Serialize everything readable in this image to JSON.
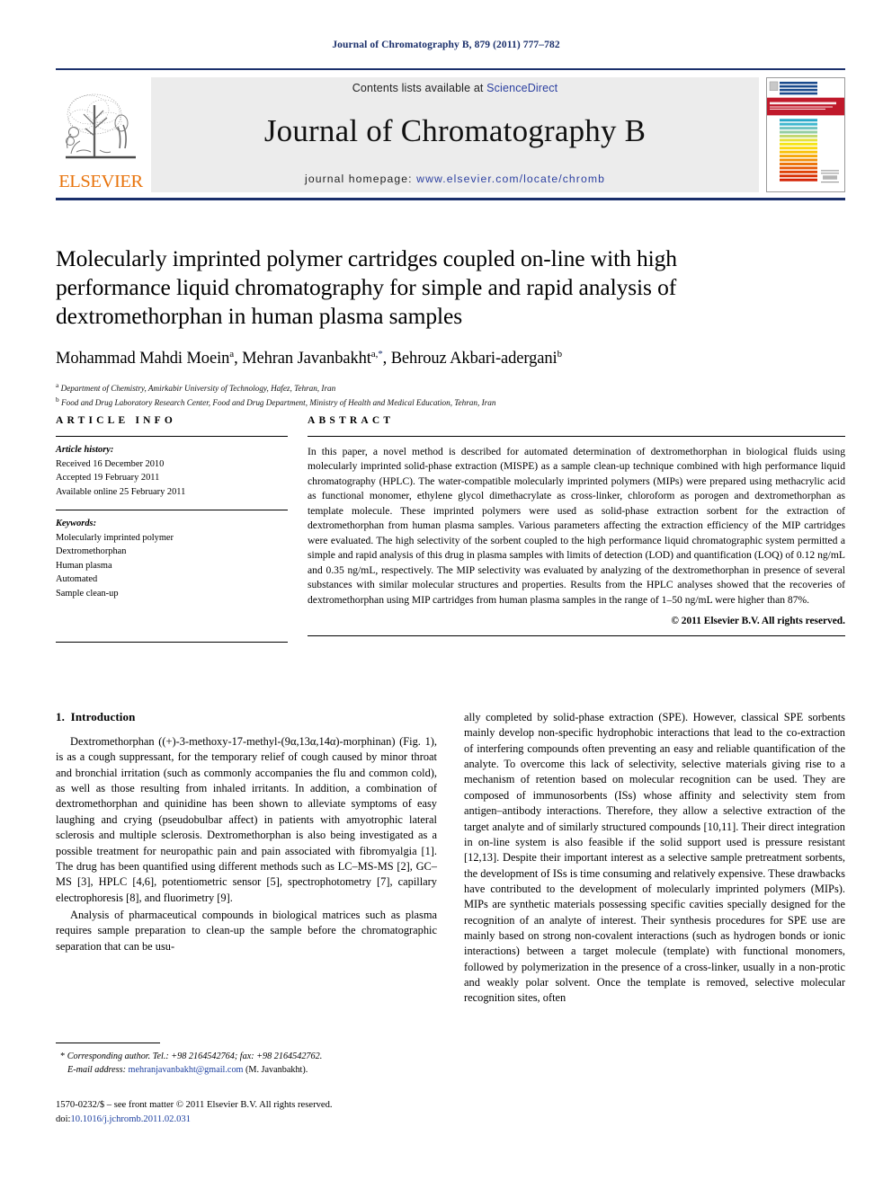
{
  "running_head": "Journal of Chromatography B, 879 (2011) 777–782",
  "masthead": {
    "contents_prefix": "Contents lists available at ",
    "sciencedirect": "ScienceDirect",
    "journal_title": "Journal of Chromatography B",
    "homepage_prefix": "journal homepage: ",
    "homepage_url": "www.elsevier.com/locate/chromb",
    "publisher": "ELSEVIER",
    "cover_title": "JOURNAL OF CHROMATOGRAPHY B",
    "accent_blue": "#1a2f6b",
    "link_blue": "#2b3fa0",
    "elsevier_orange": "#E8730B",
    "cover_red": "#c0192b"
  },
  "article": {
    "title": "Molecularly imprinted polymer cartridges coupled on-line with high performance liquid chromatography for simple and rapid analysis of dextromethorphan in human plasma samples",
    "authors_html": "Mohammad Mahdi Moein<sup>a</sup>, Mehran Javanbakht<sup>a,<span class=\"star\">*</span></sup>, Behrouz Akbari-adergani<sup>b</sup>",
    "affiliations": [
      {
        "mark": "a",
        "text": "Department of Chemistry, Amirkabir University of Technology, Hafez, Tehran, Iran"
      },
      {
        "mark": "b",
        "text": "Food and Drug Laboratory Research Center, Food and Drug Department, Ministry of Health and Medical Education, Tehran, Iran"
      }
    ]
  },
  "article_info": {
    "heading": "ARTICLE INFO",
    "history_label": "Article history:",
    "history": [
      "Received 16 December 2010",
      "Accepted 19 February 2011",
      "Available online 25 February 2011"
    ],
    "keywords_label": "Keywords:",
    "keywords": [
      "Molecularly imprinted polymer",
      "Dextromethorphan",
      "Human plasma",
      "Automated",
      "Sample clean-up"
    ]
  },
  "abstract": {
    "heading": "ABSTRACT",
    "text": "In this paper, a novel method is described for automated determination of dextromethorphan in biological fluids using molecularly imprinted solid-phase extraction (MISPE) as a sample clean-up technique combined with high performance liquid chromatography (HPLC). The water-compatible molecularly imprinted polymers (MIPs) were prepared using methacrylic acid as functional monomer, ethylene glycol dimethacrylate as cross-linker, chloroform as porogen and dextromethorphan as template molecule. These imprinted polymers were used as solid-phase extraction sorbent for the extraction of dextromethorphan from human plasma samples. Various parameters affecting the extraction efficiency of the MIP cartridges were evaluated. The high selectivity of the sorbent coupled to the high performance liquid chromatographic system permitted a simple and rapid analysis of this drug in plasma samples with limits of detection (LOD) and quantification (LOQ) of 0.12 ng/mL and 0.35 ng/mL, respectively. The MIP selectivity was evaluated by analyzing of the dextromethorphan in presence of several substances with similar molecular structures and properties. Results from the HPLC analyses showed that the recoveries of dextromethorphan using MIP cartridges from human plasma samples in the range of 1–50 ng/mL were higher than 87%.",
    "copyright": "© 2011 Elsevier B.V. All rights reserved."
  },
  "introduction": {
    "section_number": "1.",
    "section_title": "Introduction",
    "left_paragraphs": [
      "Dextromethorphan ((+)-3-methoxy-17-methyl-(9α,13α,14α)-morphinan) (Fig. 1), is as a cough suppressant, for the temporary relief of cough caused by minor throat and bronchial irritation (such as commonly accompanies the flu and common cold), as well as those resulting from inhaled irritants. In addition, a combination of dextromethorphan and quinidine has been shown to alleviate symptoms of easy laughing and crying (pseudobulbar affect) in patients with amyotrophic lateral sclerosis and multiple sclerosis. Dextromethorphan is also being investigated as a possible treatment for neuropathic pain and pain associated with fibromyalgia [1]. The drug has been quantified using different methods such as LC–MS-MS [2], GC–MS [3], HPLC [4,6], potentiometric sensor [5], spectrophotometry [7], capillary electrophoresis [8], and fluorimetry [9].",
      "Analysis of pharmaceutical compounds in biological matrices such as plasma requires sample preparation to clean-up the sample before the chromatographic separation that can be usu-"
    ],
    "right_paragraphs": [
      "ally completed by solid-phase extraction (SPE). However, classical SPE sorbents mainly develop non-specific hydrophobic interactions that lead to the co-extraction of interfering compounds often preventing an easy and reliable quantification of the analyte. To overcome this lack of selectivity, selective materials giving rise to a mechanism of retention based on molecular recognition can be used. They are composed of immunosorbents (ISs) whose affinity and selectivity stem from antigen–antibody interactions. Therefore, they allow a selective extraction of the target analyte and of similarly structured compounds [10,11]. Their direct integration in on-line system is also feasible if the solid support used is pressure resistant [12,13]. Despite their important interest as a selective sample pretreatment sorbents, the development of ISs is time consuming and relatively expensive. These drawbacks have contributed to the development of molecularly imprinted polymers (MIPs). MIPs are synthetic materials possessing specific cavities specially designed for the recognition of an analyte of interest. Their synthesis procedures for SPE use are mainly based on strong non-covalent interactions (such as hydrogen bonds or ionic interactions) between a target molecule (template) with functional monomers, followed by polymerization in the presence of a cross-linker, usually in a non-protic and weakly polar solvent. Once the template is removed, selective molecular recognition sites, often"
    ]
  },
  "footnotes": {
    "corresponding": "Corresponding author. Tel.: +98 2164542764; fax: +98 2164542762.",
    "email_label": "E-mail address:",
    "email": "mehranjavanbakht@gmail.com",
    "email_suffix": "(M. Javanbakht).",
    "issn_line": "1570-0232/$ – see front matter © 2011 Elsevier B.V. All rights reserved.",
    "doi_label": "doi:",
    "doi_value": "10.1016/j.jchromb.2011.02.031"
  }
}
